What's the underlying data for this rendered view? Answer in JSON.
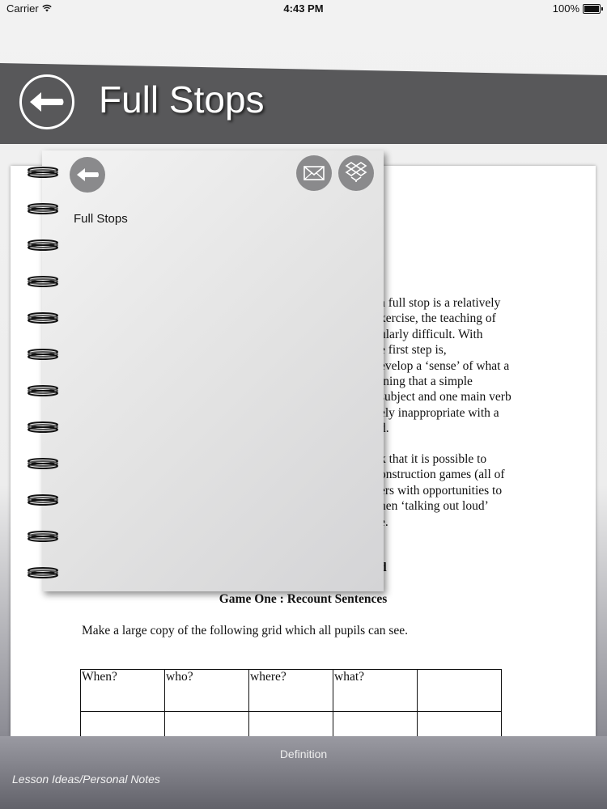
{
  "status_bar": {
    "carrier": "Carrier",
    "time": "4:43 PM",
    "battery": "100%"
  },
  "header": {
    "title": "Full Stops",
    "back_icon": "left-arrow-icon"
  },
  "notebook": {
    "title": "Full Stops",
    "icons": [
      "back-arrow-icon",
      "mail-icon",
      "dropbox-icon"
    ],
    "spiral_rings": 12
  },
  "document": {
    "paragraph1": [
      "a full stop is a relatively",
      "xercise, the teaching of",
      "ularly difficult.  With",
      "e first step is,",
      "evelop a ‘sense’ of what a",
      "ining that a simple",
      "subject and one main verb",
      "ely inappropriate with a",
      "d."
    ],
    "paragraph2": [
      "k that it is possible to",
      "onstruction games (all of",
      "ers with opportunities to",
      "hen ‘talking out loud’",
      "e."
    ],
    "heading_fragment": "d",
    "game_title": "Game One : Recount Sentences",
    "instruction": "Make a large copy of the following grid which all pupils can see.",
    "table": {
      "headers": [
        "When?",
        "who?",
        "where?",
        "what?",
        ""
      ],
      "rows": [
        [
          "",
          "",
          "",
          "",
          ""
        ]
      ]
    }
  },
  "bottom_bar": {
    "definition": "Definition",
    "notes": "Lesson Ideas/Personal Notes"
  },
  "colors": {
    "header_band": "#58585a",
    "icon_circle": "#8a8a8c"
  }
}
